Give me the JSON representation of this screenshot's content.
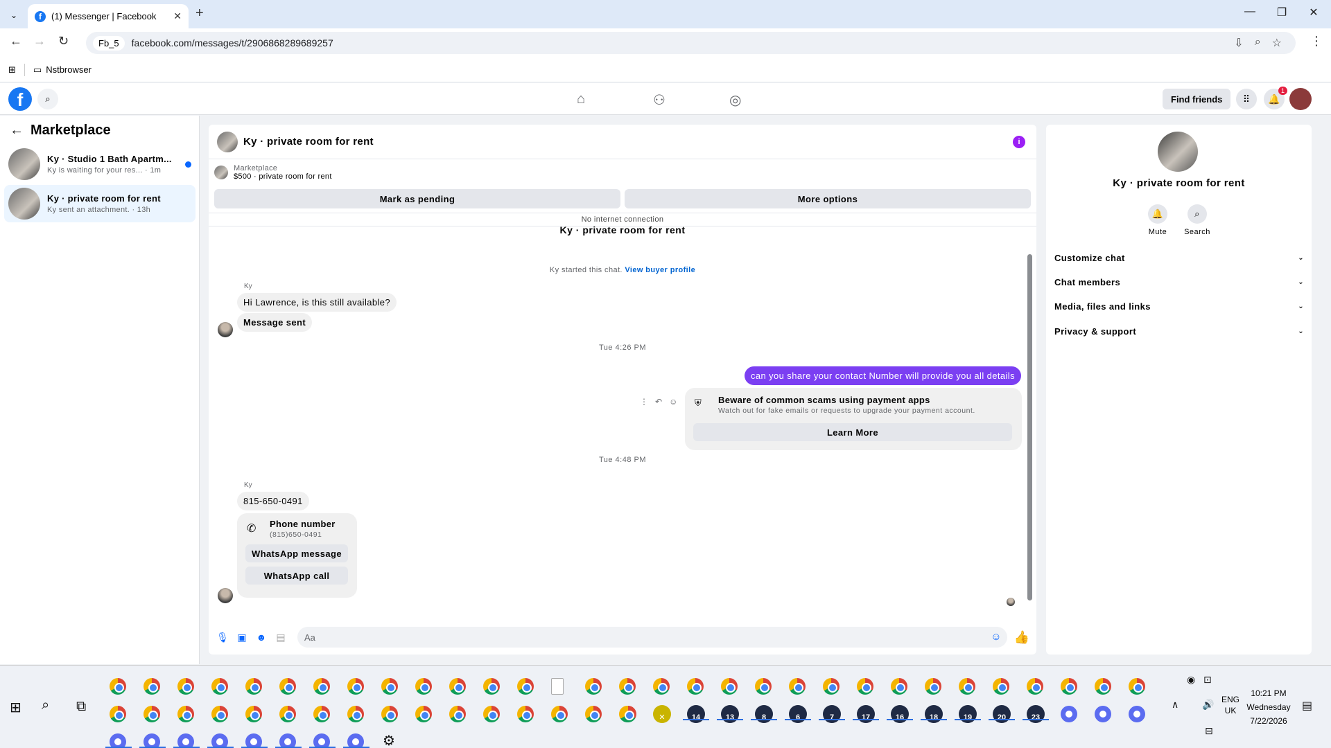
{
  "browser": {
    "tab_title": "(1) Messenger | Facebook",
    "profile_label": "Fb_5",
    "url": "facebook.com/messages/t/2906868289689257",
    "bookmark": "Nstbrowser"
  },
  "fb_header": {
    "find_friends": "Find friends",
    "notification_count": "1"
  },
  "left_panel": {
    "title": "Marketplace",
    "conversations": [
      {
        "title": "Ky · Studio 1 Bath Apartm...",
        "subtitle": "Ky is waiting for your res... · 1m",
        "unread": true
      },
      {
        "title": "Ky · private room for rent",
        "subtitle": "Ky sent an attachment. · 13h",
        "unread": false
      }
    ]
  },
  "chat": {
    "header_name": "Ky · private room for rent",
    "marketplace_label": "Marketplace",
    "listing": "$500 · private room for rent",
    "mark_pending": "Mark as pending",
    "more_options": "More options",
    "no_internet": "No internet connection",
    "big_name": "Ky · private room for rent",
    "started_text": "Ky started this chat.",
    "view_buyer_profile": "View buyer profile",
    "sender1": "Ky",
    "msg1": "Hi Lawrence, is this still available?",
    "msg2": "Message sent",
    "time1": "Tue 4:26 PM",
    "outgoing": "can you share your contact Number will provide you all details",
    "scam_title": "Beware of common scams using payment apps",
    "scam_sub": "Watch out for fake emails or requests to upgrade your payment account.",
    "learn_more": "Learn More",
    "time2": "Tue 4:48 PM",
    "sender2": "Ky",
    "phone_msg": "815-650-0491",
    "phone_card_title": "Phone number",
    "phone_card_num": "(815)650-0491",
    "whatsapp_message": "WhatsApp message",
    "whatsapp_call": "WhatsApp call",
    "input_placeholder": "Aa"
  },
  "right_panel": {
    "name": "Ky · private room for rent",
    "mute": "Mute",
    "search": "Search",
    "sections": [
      "Customize chat",
      "Chat members",
      "Media, files and links",
      "Privacy & support"
    ]
  },
  "taskbar": {
    "badges": [
      "14",
      "13",
      "8",
      "6",
      "7",
      "17",
      "16",
      "18",
      "19",
      "20",
      "23"
    ],
    "lang1": "ENG",
    "lang2": "UK",
    "time": "10:21 PM",
    "day": "Wednesday",
    "date": "7/22/2026"
  },
  "colors": {
    "accent": "#0866ff",
    "outgoing_bubble": "#7b3ff2",
    "fb_blue": "#1877f2"
  }
}
